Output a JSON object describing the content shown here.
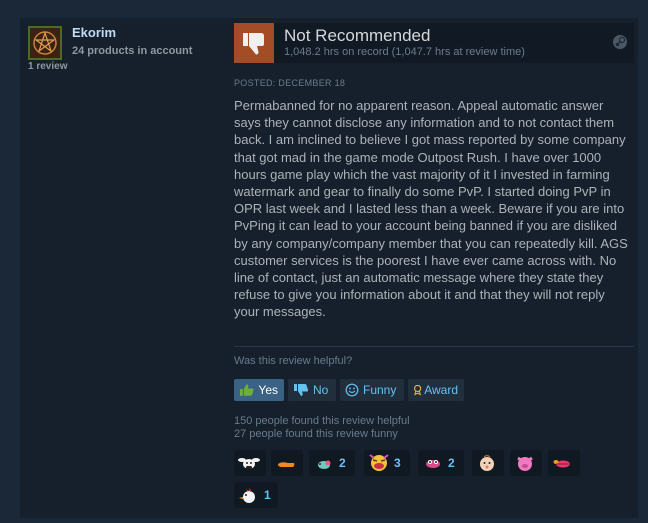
{
  "author": {
    "name": "Ekorim",
    "products": "24 products in account",
    "reviews": "1 review"
  },
  "recommendation": {
    "title": "Not Recommended",
    "hours": "1,048.2 hrs on record (1,047.7 hrs at review time)"
  },
  "posted": "POSTED: DECEMBER 18",
  "content": "Permabanned for no apparent reason. Appeal automatic answer says they cannot disclose any information and to not contact them back. I am inclined to believe I got mass reported by some company that got mad in the game mode Outpost Rush. I have over 1000 hours game play which the vast majority of it I invested in farming watermark and gear to finally do some PvP. I started doing PvP in OPR last week and I lasted less than a week. Beware if you are into PvPing it can lead to your account being banned if you are disliked by any company/company member that you can repeatedly kill. AGS customer services is the poorest I have ever came across with. No line of contact, just an automatic message where they state they refuse to give you information about it and that they will not reply your messages.",
  "vote": {
    "question": "Was this review helpful?",
    "yes": "Yes",
    "no": "No",
    "funny": "Funny",
    "award": "Award"
  },
  "stats": {
    "helpful": "150 people found this review helpful",
    "funny": "27 people found this review funny"
  },
  "awards": [
    {
      "name": "cow-award-icon",
      "count": ""
    },
    {
      "name": "arm-award-icon",
      "count": ""
    },
    {
      "name": "bird-award-icon",
      "count": "2"
    },
    {
      "name": "laughing-face-award-icon",
      "count": "3"
    },
    {
      "name": "pig-face-award-icon",
      "count": "2"
    },
    {
      "name": "baby-face-award-icon",
      "count": ""
    },
    {
      "name": "pink-pig-award-icon",
      "count": ""
    },
    {
      "name": "lips-award-icon",
      "count": ""
    },
    {
      "name": "chicken-award-icon",
      "count": "1"
    }
  ],
  "colors": {
    "background": "#1b2838",
    "panel": "#16202d",
    "thumb_down": "#a34c25",
    "link": "#66c0f4",
    "active_button": "#3a6285"
  }
}
